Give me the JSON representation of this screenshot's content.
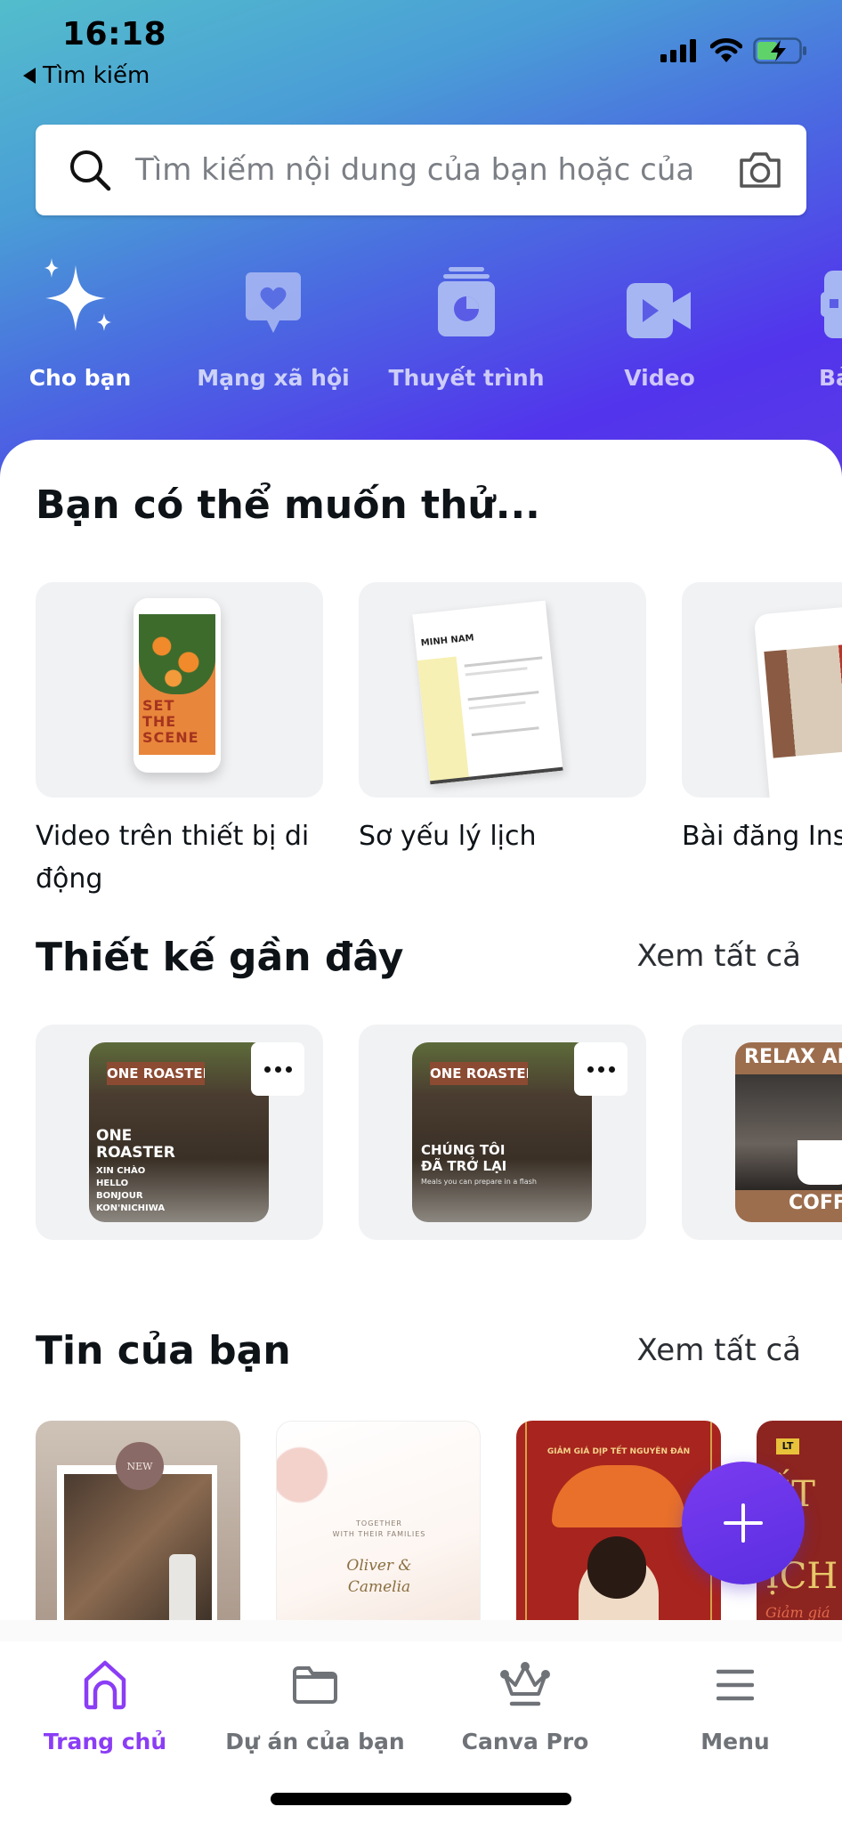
{
  "status_bar": {
    "time": "16:18",
    "back_label": "Tìm kiếm",
    "icons": [
      "cellular-signal-icon",
      "wifi-icon",
      "battery-charging-icon"
    ]
  },
  "search": {
    "placeholder": "Tìm kiếm nội dung của bạn hoặc của",
    "left_icon": "search-icon",
    "right_icon": "camera-icon"
  },
  "categories": [
    {
      "label": "Cho bạn",
      "icon": "sparkle-icon",
      "active": true
    },
    {
      "label": "Mạng xã hội",
      "icon": "heart-bubble-icon",
      "active": false
    },
    {
      "label": "Thuyết trình",
      "icon": "presentation-chart-icon",
      "active": false
    },
    {
      "label": "Video",
      "icon": "video-camera-icon",
      "active": false
    },
    {
      "label": "Bả",
      "icon": "print-icon",
      "active": false
    }
  ],
  "suggestions": {
    "title": "Bạn có thể muốn thử...",
    "items": [
      {
        "label": "Video trên thiết bị di động",
        "thumb_text": "SET THE SCENE"
      },
      {
        "label": "Sơ yếu lý lịch",
        "thumb_text": "MINH NAM"
      },
      {
        "label": "Bài đăng Ins",
        "thumb_text": ""
      }
    ]
  },
  "recent_designs": {
    "title": "Thiết kế gần đây",
    "see_all": "Xem tất cả",
    "items": [
      {
        "thumb_header": "ONE ROASTER",
        "thumb_text": "ONE ROASTER",
        "thumb_lines": [
          "XIN CHÀO",
          "HELLO",
          "BONJOUR",
          "KON'NICHIWA"
        ]
      },
      {
        "thumb_header": "ONE ROASTER",
        "thumb_text": "CHÚNG TÔI ĐÃ TRỞ LẠI",
        "thumb_lines": [
          "Meals you can prepare in a flash"
        ]
      },
      {
        "thumb_header": "RELAX AND",
        "thumb_text": "COFFEE",
        "thumb_lines": []
      }
    ],
    "more_label": "•••"
  },
  "stories": {
    "title": "Tin của bạn",
    "see_all": "Xem tất cả",
    "items": [
      {
        "badge": "NEW"
      },
      {
        "line1": "TOGETHER",
        "line2": "WITH THEIR FAMILIES",
        "names": "Oliver & Camelia"
      },
      {
        "arc_text": "GIẢM GIÁ DỊP TẾT NGUYÊN ĐÁN"
      },
      {
        "logo": "LT",
        "title": "ẾT M ỊCH",
        "subtitle": "Giảm giá"
      }
    ]
  },
  "fab": {
    "label": "+",
    "icon": "plus-icon"
  },
  "bottom_nav": [
    {
      "label": "Trang chủ",
      "icon": "home-icon",
      "active": true
    },
    {
      "label": "Dự án của bạn",
      "icon": "folder-icon",
      "active": false
    },
    {
      "label": "Canva Pro",
      "icon": "crown-icon",
      "active": false
    },
    {
      "label": "Menu",
      "icon": "hamburger-menu-icon",
      "active": false
    }
  ],
  "colors": {
    "accent": "#8b3df5",
    "fab": "#6a34ea",
    "card_bg": "#f1f2f4",
    "gradient_start": "#53bdcc",
    "gradient_end": "#5234ec"
  }
}
